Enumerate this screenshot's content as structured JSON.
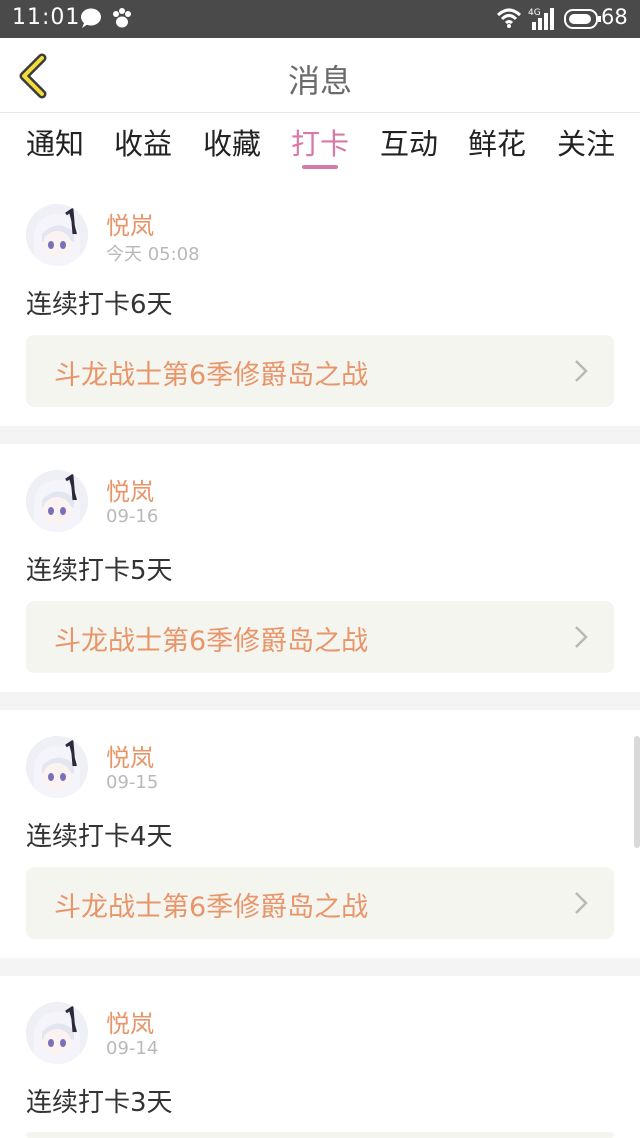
{
  "status_bar": {
    "time": "11:01",
    "network": "4G",
    "battery": "68"
  },
  "header": {
    "title": "消息"
  },
  "tabs": [
    {
      "label": "通知"
    },
    {
      "label": "收益"
    },
    {
      "label": "收藏"
    },
    {
      "label": "打卡",
      "active": true
    },
    {
      "label": "互动"
    },
    {
      "label": "鲜花"
    },
    {
      "label": "关注"
    }
  ],
  "messages": [
    {
      "username": "悦岚",
      "time": "今天 05:08",
      "text": "连续打卡6天",
      "link": "斗龙战士第6季修爵岛之战"
    },
    {
      "username": "悦岚",
      "time": "09-16",
      "text": "连续打卡5天",
      "link": "斗龙战士第6季修爵岛之战"
    },
    {
      "username": "悦岚",
      "time": "09-15",
      "text": "连续打卡4天",
      "link": "斗龙战士第6季修爵岛之战"
    },
    {
      "username": "悦岚",
      "time": "09-14",
      "text": "连续打卡3天",
      "link": ""
    }
  ],
  "colors": {
    "accent": "#d77aa8",
    "username": "#e8956a",
    "status_bar": "#4a4a4a"
  }
}
